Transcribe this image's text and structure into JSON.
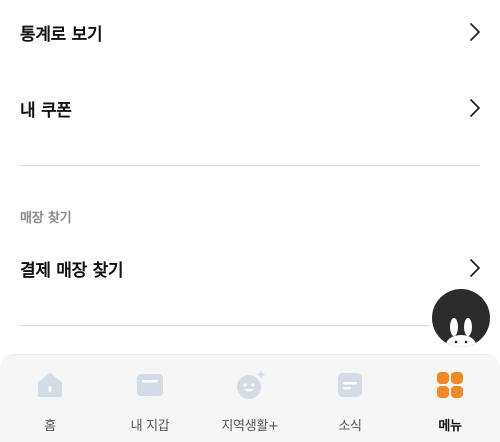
{
  "menu": {
    "stats": {
      "label": "통계로 보기",
      "icon": "chevron-right-icon"
    },
    "coupons": {
      "label": "내 쿠폰",
      "icon": "chevron-right-icon"
    },
    "store_section": {
      "title": "매장 찾기",
      "find_store": {
        "label": "결제 매장 찾기",
        "icon": "chevron-right-icon"
      }
    }
  },
  "fab": {
    "icon": "rabbit-character-icon"
  },
  "tabbar": {
    "tabs": [
      {
        "label": "홈",
        "icon": "home-icon",
        "active": false
      },
      {
        "label": "내 지갑",
        "icon": "wallet-icon",
        "active": false
      },
      {
        "label": "지역생활+",
        "icon": "smile-sparkle-icon",
        "active": false
      },
      {
        "label": "소식",
        "icon": "news-icon",
        "active": false
      },
      {
        "label": "메뉴",
        "icon": "grid-menu-icon",
        "active": true
      }
    ]
  },
  "colors": {
    "accent": "#f08a24",
    "inactive_icon": "#d3dbe6",
    "section_title": "#8a8a8a",
    "tabbar_bg": "#f6f6f6",
    "fab_bg": "#2b2b2b"
  }
}
